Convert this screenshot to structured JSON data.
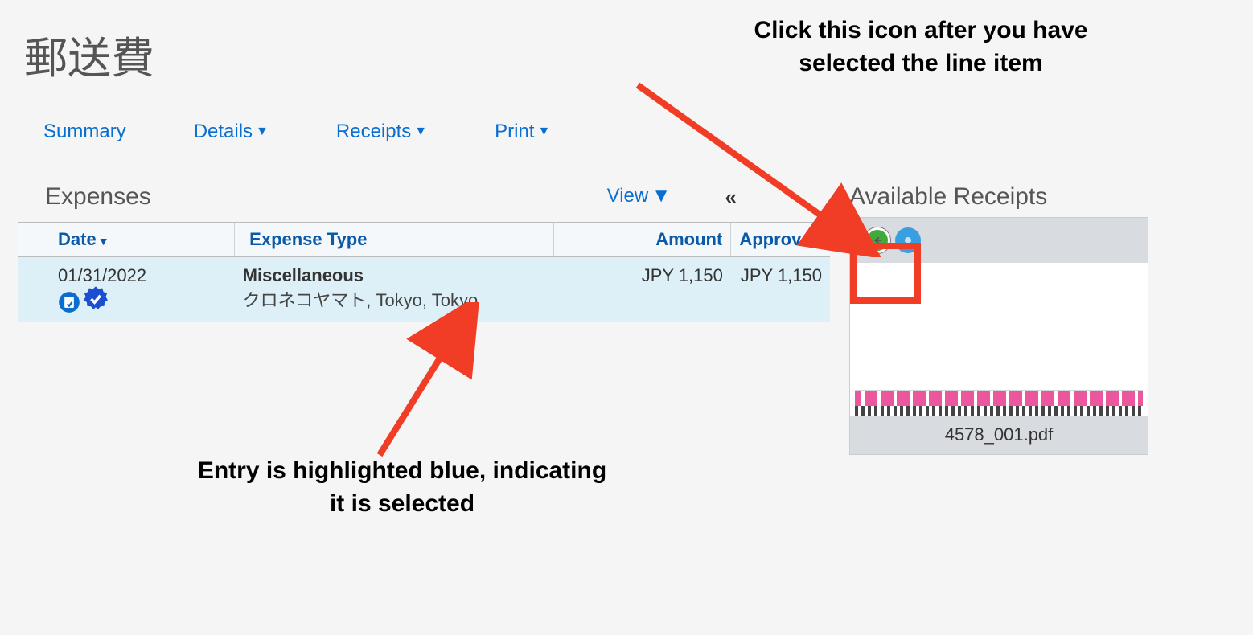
{
  "page": {
    "title": "郵送費"
  },
  "tabs": {
    "summary": "Summary",
    "details": "Details",
    "receipts": "Receipts",
    "print": "Print"
  },
  "expenses": {
    "title": "Expenses",
    "view_label": "View",
    "columns": {
      "date": "Date",
      "type": "Expense Type",
      "amount": "Amount",
      "approved": "Approved"
    },
    "rows": [
      {
        "date": "01/31/2022",
        "type": "Miscellaneous",
        "location": "クロネコヤマト, Tokyo, Tokyo",
        "amount": "JPY 1,150",
        "approved": "JPY 1,150",
        "selected": true
      }
    ]
  },
  "receipts_panel": {
    "title": "Available Receipts",
    "filename": "4578_001.pdf"
  },
  "annotations": {
    "top": "Click this icon after you have selected the line item",
    "bottom": "Entry is highlighted blue, indicating it is selected"
  }
}
